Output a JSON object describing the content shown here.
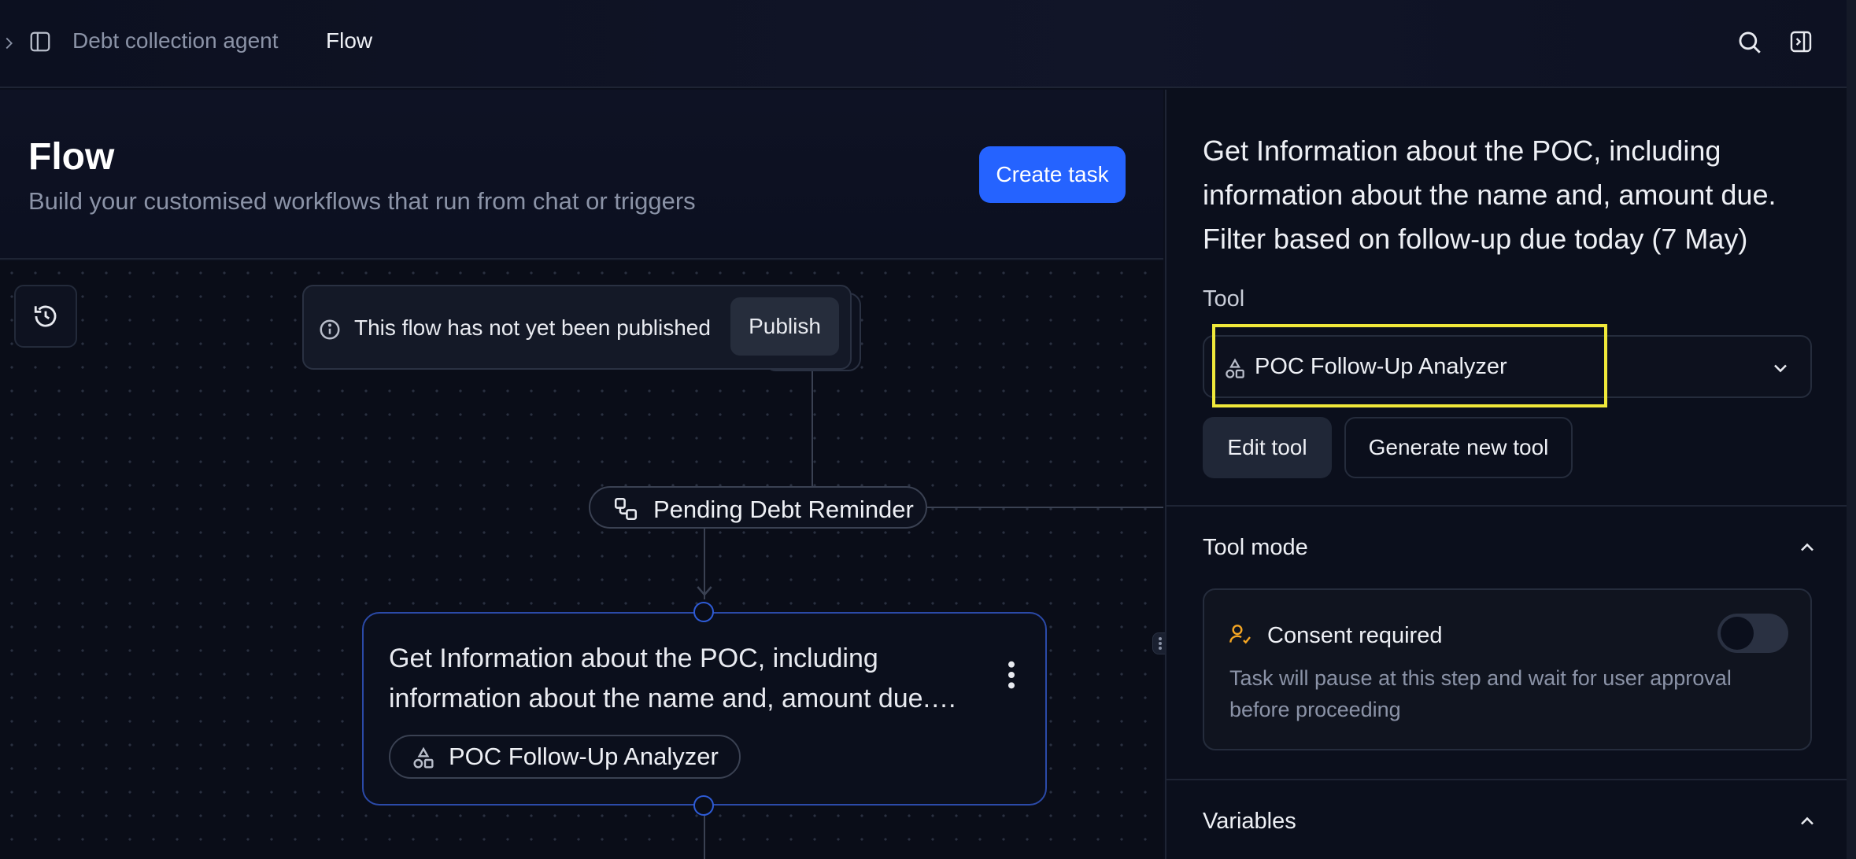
{
  "breadcrumb": {
    "agent": "Debt collection agent",
    "current": "Flow"
  },
  "header": {
    "title": "Flow",
    "subtitle": "Build your customised workflows that run from chat or triggers",
    "create_task_label": "Create task"
  },
  "canvas": {
    "banner_text": "This flow has not yet been published",
    "publish_label": "Publish",
    "trigger_pill_label": "Pending Debt Reminder",
    "task_node": {
      "text": "Get Information about the POC, including information about the name and, amount due. Filter based on follow-up due today (7 May)",
      "tool_chip_label": "POC Follow-Up Analyzer"
    }
  },
  "panel": {
    "description": "Get Information about the POC, including information about the name and, amount due. Filter based on follow-up due today (7 May)",
    "tool_label": "Tool",
    "tool_selected": "POC Follow-Up Analyzer",
    "edit_tool_label": "Edit tool",
    "generate_tool_label": "Generate new tool",
    "tool_mode_title": "Tool mode",
    "consent_title": "Consent required",
    "consent_desc": "Task will pause at this step and wait for user approval before proceeding",
    "consent_enabled": false,
    "variables_title": "Variables"
  },
  "colors": {
    "accent": "#2563ff",
    "highlight": "#f0e83a",
    "consent_icon": "#f5a623",
    "node_border": "#2b4aa8"
  },
  "icons": [
    "sidebar-toggle-icon",
    "chevron-right-icon",
    "search-icon",
    "panel-icon",
    "history-icon",
    "info-icon",
    "workflow-icon",
    "shapes-icon",
    "kebab-icon",
    "chevron-down-icon",
    "chevron-up-icon",
    "user-check-icon"
  ]
}
